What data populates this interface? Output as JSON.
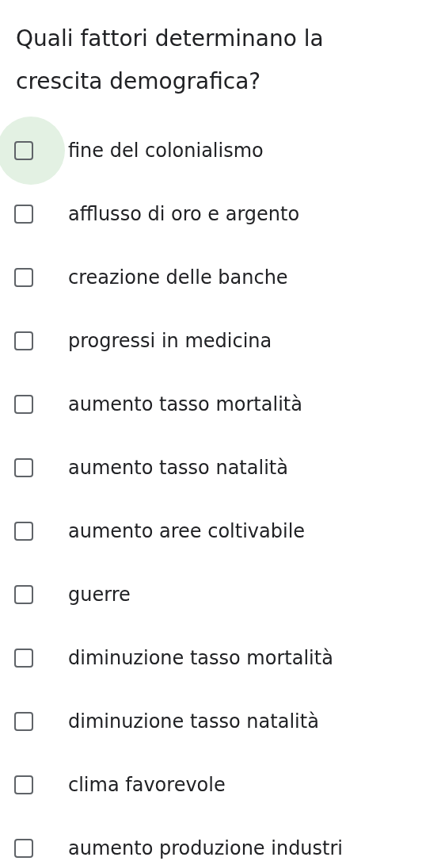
{
  "question": "Quali fattori determinano la crescita demografica?",
  "options": [
    {
      "label": "fine del colonialismo",
      "checked": false,
      "focused": true
    },
    {
      "label": "afflusso di oro e argento",
      "checked": false,
      "focused": false
    },
    {
      "label": "creazione delle banche",
      "checked": false,
      "focused": false
    },
    {
      "label": "progressi in medicina",
      "checked": false,
      "focused": false
    },
    {
      "label": "aumento tasso mortalità",
      "checked": false,
      "focused": false
    },
    {
      "label": "aumento tasso natalità",
      "checked": false,
      "focused": false
    },
    {
      "label": "aumento aree coltivabile",
      "checked": false,
      "focused": false
    },
    {
      "label": "guerre",
      "checked": false,
      "focused": false
    },
    {
      "label": "diminuzione tasso mortalità",
      "checked": false,
      "focused": false
    },
    {
      "label": "diminuzione tasso natalità",
      "checked": false,
      "focused": false
    },
    {
      "label": "clima favorevole",
      "checked": false,
      "focused": false
    },
    {
      "label": "aumento produzione industri",
      "checked": false,
      "focused": false
    }
  ]
}
